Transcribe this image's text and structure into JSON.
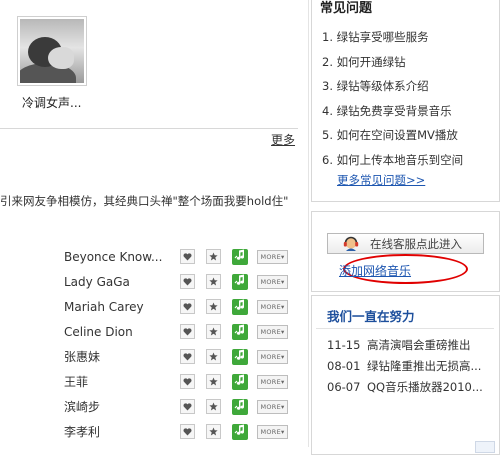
{
  "album": {
    "title": "冷调女声..."
  },
  "section": {
    "more_label": "更多"
  },
  "blurb": "引来网友争相模仿，其经典口头禅\"整个场面我要hold住\"",
  "artists": [
    {
      "name": "Beyonce Know..."
    },
    {
      "name": "Lady GaGa"
    },
    {
      "name": "Mariah Carey"
    },
    {
      "name": "Celine Dion"
    },
    {
      "name": "张惠妹"
    },
    {
      "name": "王菲"
    },
    {
      "name": "滨崎步"
    },
    {
      "name": "李孝利"
    }
  ],
  "artist_more_label": "MORE▾",
  "faq": {
    "title": "常见问题",
    "items": [
      "1. 绿钻享受哪些服务",
      "2. 如何开通绿钻",
      "3. 绿钻等级体系介绍",
      "4. 绿钻免费享受背景音乐",
      "5. 如何在空间设置MV播放",
      "6. 如何上传本地音乐到空间"
    ],
    "more": "更多常见问题>>"
  },
  "service": {
    "button_label": "在线客服点此进入",
    "add_music": "添加网络音乐"
  },
  "news": {
    "title": "我们一直在努力",
    "items": [
      {
        "date": "11-15",
        "text": "高清演唱会重磅推出"
      },
      {
        "date": "08-01",
        "text": "绿钻隆重推出无损高..."
      },
      {
        "date": "06-07",
        "text": "QQ音乐播放器2010..."
      }
    ]
  },
  "colors": {
    "link": "#1d56b0",
    "news_title": "#1d4f9c",
    "highlight": "#e00000",
    "green_button": "#3fa83a"
  }
}
